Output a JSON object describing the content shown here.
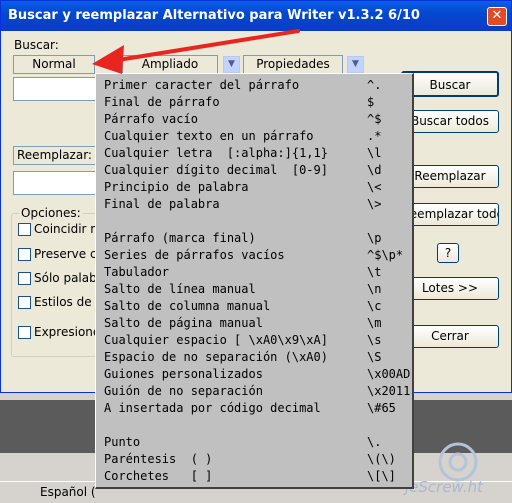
{
  "window": {
    "title": "Buscar y reemplazar Alternativo para Writer v1.3.2  6/10",
    "close": "✕"
  },
  "search": {
    "label": "Buscar:",
    "mode_normal": "Normal",
    "mode_ampliado": "Ampliado",
    "mode_propiedades": "Propiedades"
  },
  "replace": {
    "label": "Reemplazar:"
  },
  "buttons": {
    "buscar": "Buscar",
    "buscar_todos": "Buscar todos",
    "reemplazar": "Reemplazar",
    "reemplazar_todo": "Reemplazar todo",
    "help": "?",
    "lotes": "Lotes >>",
    "cerrar": "Cerrar"
  },
  "options": {
    "title": "Opciones:",
    "items": [
      "Coincidir m",
      "Preserve c",
      "Sólo palab",
      "Estilos de p",
      "Expresione"
    ]
  },
  "menu": [
    {
      "label": "Primer caracter del párrafo",
      "code": "^."
    },
    {
      "label": "Final de párrafo",
      "code": "$"
    },
    {
      "label": "Párrafo vacío",
      "code": "^$"
    },
    {
      "label": "Cualquier texto en un párrafo",
      "code": ".*"
    },
    {
      "label": "Cualquier letra  [:alpha:]{1,1}",
      "code": "\\l"
    },
    {
      "label": "Cualquier dígito decimal  [0-9]",
      "code": "\\d"
    },
    {
      "label": "Principio de palabra",
      "code": "\\<"
    },
    {
      "label": "Final de palabra",
      "code": "\\>"
    },
    {
      "label": "",
      "code": ""
    },
    {
      "label": "Párrafo (marca final)",
      "code": "\\p"
    },
    {
      "label": "Series de párrafos vacíos",
      "code": "^$\\p*"
    },
    {
      "label": "Tabulador",
      "code": "\\t"
    },
    {
      "label": "Salto de línea manual",
      "code": "\\n"
    },
    {
      "label": "Salto de columna manual",
      "code": "\\c"
    },
    {
      "label": "Salto de página manual",
      "code": "\\m"
    },
    {
      "label": "Cualquier espacio [ \\xA0\\x9\\xA]",
      "code": "\\s"
    },
    {
      "label": "Espacio de no separación (\\xA0)",
      "code": "\\S"
    },
    {
      "label": "Guiones personalizados",
      "code": "\\x00AD"
    },
    {
      "label": "Guión de no separación",
      "code": "\\x2011"
    },
    {
      "label": "A insertada por código decimal",
      "code": "\\#65"
    },
    {
      "label": "",
      "code": ""
    },
    {
      "label": "Punto",
      "code": "\\."
    },
    {
      "label": "Paréntesis  ( )",
      "code": "\\(\\)"
    },
    {
      "label": "Corchetes   [ ]",
      "code": "\\[\\]"
    }
  ],
  "statusbar": {
    "language": "Español ("
  },
  "watermark": "jeScrew.ht",
  "colors": {
    "titlebar": "#0548d0",
    "arrow": "#e8251f",
    "menu_bg": "#c0c0c0"
  }
}
